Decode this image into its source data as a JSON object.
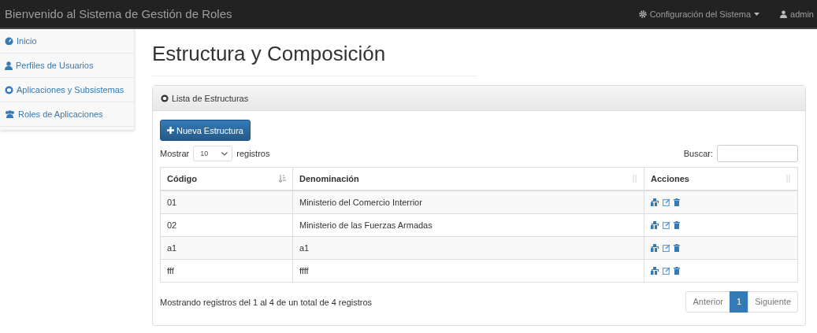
{
  "navbar": {
    "title": "Bienvenido al Sistema de Gestión de Roles",
    "menus": [
      {
        "label": "Configuración del Sistema",
        "caret": true
      },
      {
        "label": "admin",
        "caret": false
      }
    ]
  },
  "sidebar": {
    "items": [
      {
        "label": "Inicio",
        "selected": false
      },
      {
        "label": "Perfiles de Usuarios",
        "selected": false
      },
      {
        "label": "Aplicaciones y Subsistemas",
        "selected": false
      },
      {
        "label": "Roles de Aplicaciones",
        "selected": false
      }
    ]
  },
  "page_title": "Estructura y Composición",
  "panel": {
    "heading": "Lista de Estructuras",
    "new_button": "Nueva Estructura",
    "length": {
      "before": "Mostrar",
      "value": "10",
      "after": "registros"
    },
    "search": {
      "label": "Buscar:"
    },
    "table": {
      "columns": [
        {
          "label": "Código",
          "sorted": true
        },
        {
          "label": "Denominación",
          "sorted": false
        },
        {
          "label": "Acciones",
          "sorted": false
        }
      ],
      "rows": [
        {
          "code": "01",
          "name": "Ministerio del Comercio Interrior"
        },
        {
          "code": "02",
          "name": "Ministerio de las Fuerzas Armadas"
        },
        {
          "code": "a1",
          "name": "a1"
        },
        {
          "code": "fff",
          "name": "ffff"
        }
      ]
    },
    "info": "Mostrando registros del 1 al 4 de un total de 4 registros",
    "pagination": {
      "previous": "Anterior",
      "pages": [
        {
          "label": "1",
          "selected": true
        }
      ],
      "next": "Siguiente"
    }
  }
}
